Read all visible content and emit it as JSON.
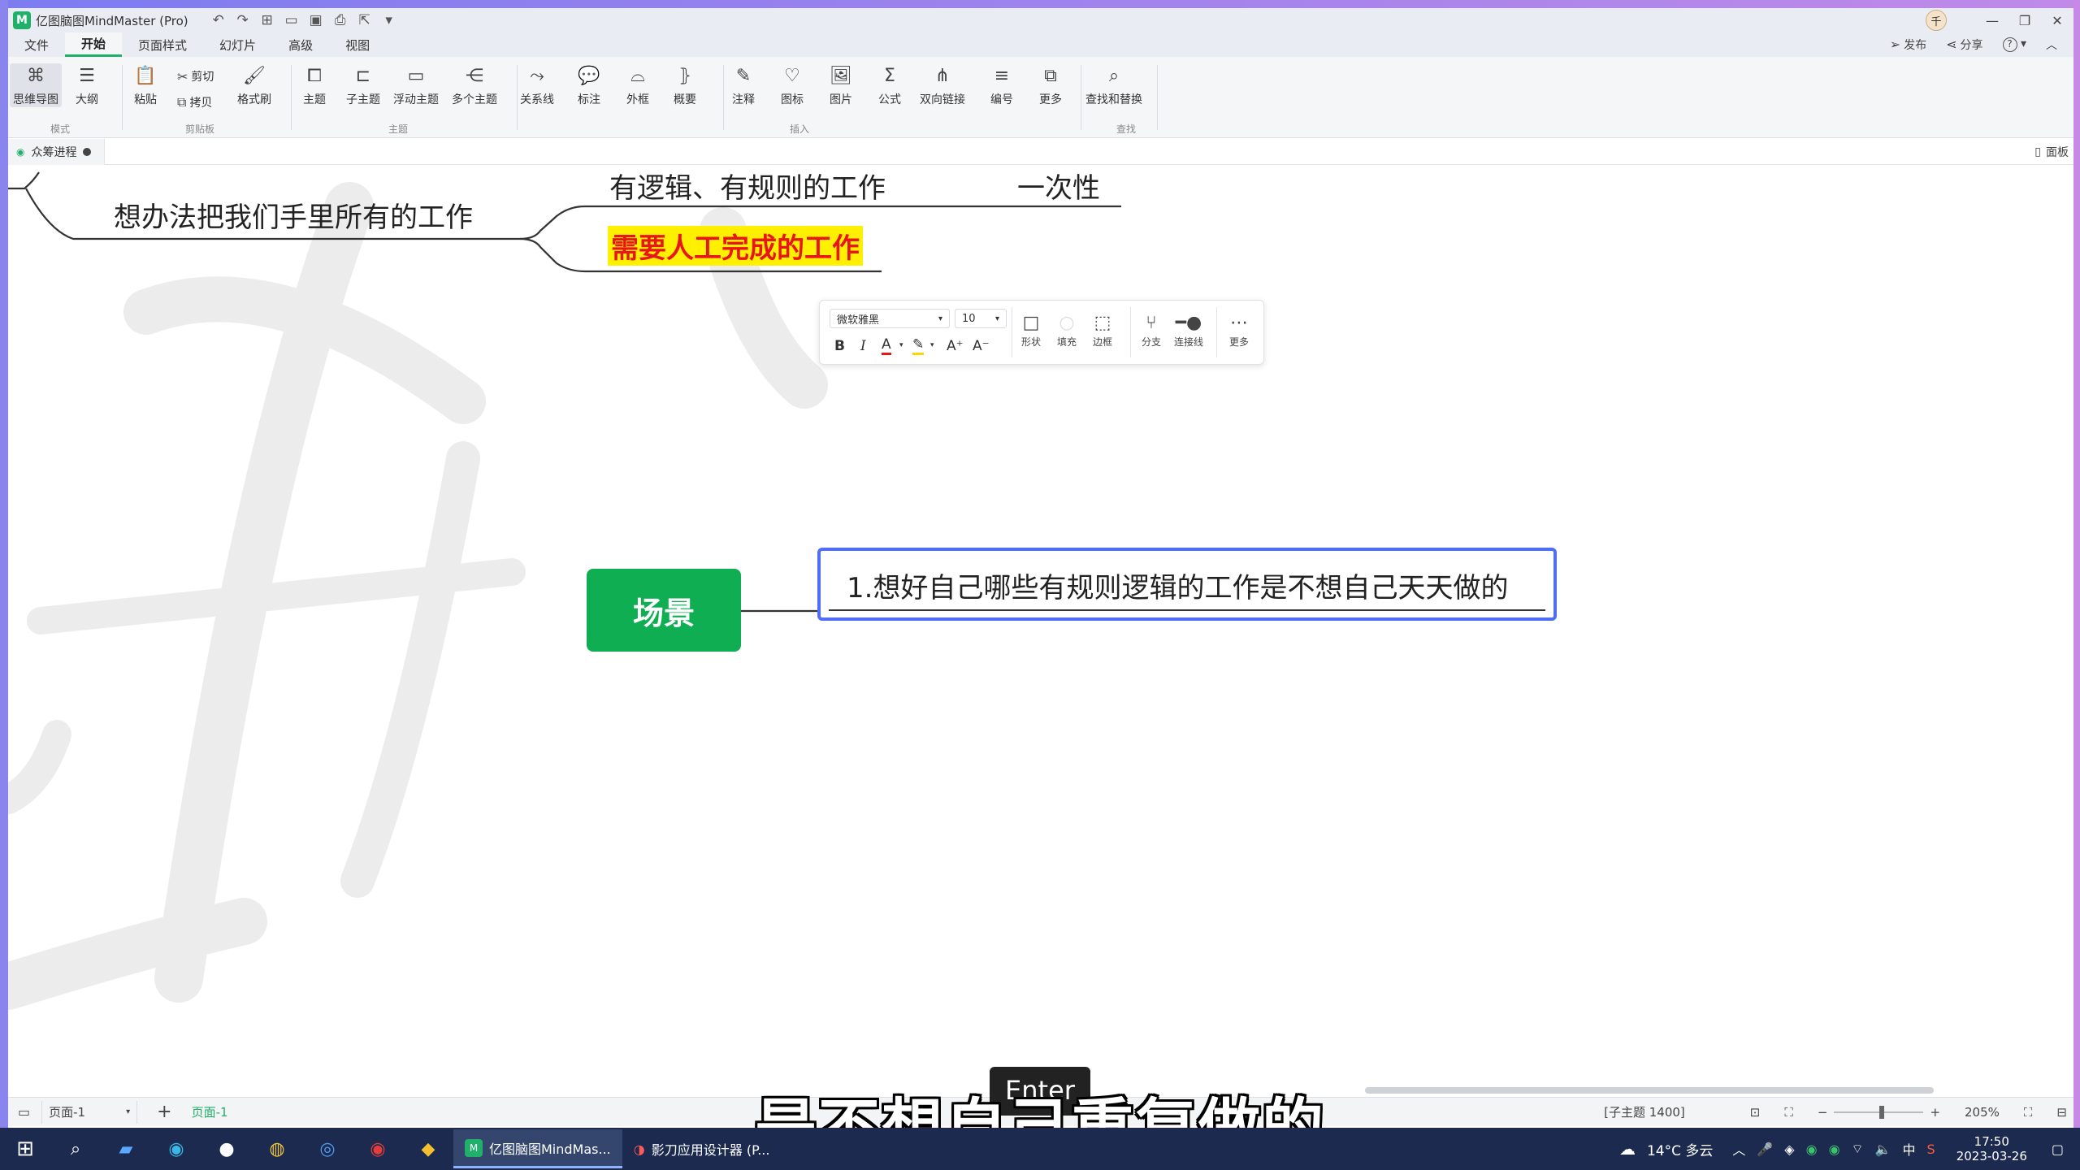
{
  "app": {
    "title": "亿图脑图MindMaster (Pro)",
    "logo_letter": "M"
  },
  "menu": {
    "tabs": [
      "文件",
      "开始",
      "页面样式",
      "幻灯片",
      "高级",
      "视图"
    ],
    "active": "开始",
    "publish": "发布",
    "share": "分享",
    "help": "?"
  },
  "ribbon": {
    "mode": {
      "mindmap": "思维导图",
      "outline": "大纲",
      "group": "模式"
    },
    "clipboard": {
      "paste": "粘贴",
      "cut": "剪切",
      "copy": "拷贝",
      "format_painter": "格式刷",
      "group": "剪贴板"
    },
    "topic": {
      "topic": "主题",
      "subtopic": "子主题",
      "floating": "浮动主题",
      "multiple": "多个主题",
      "group": "主题"
    },
    "insert": {
      "relation": "关系线",
      "callout": "标注",
      "boundary": "外框",
      "summary": "概要",
      "note": "注释",
      "icon": "图标",
      "image": "图片",
      "formula": "公式",
      "bilink": "双向链接",
      "numbering": "编号",
      "more": "更多",
      "group": "插入"
    },
    "find": {
      "find_replace": "查找和替换",
      "group": "查找"
    }
  },
  "doc": {
    "tab_name": "众筹进程",
    "panel": "面板"
  },
  "canvas": {
    "topics": {
      "parent": "想办法把我们手里所有的工作",
      "child1": "有逻辑、有规则的工作",
      "child1_tag": "一次性",
      "child2": "需要人工完成的工作",
      "central": "场景",
      "selected": "1.想好自己哪些有规则逻辑的工作是不想自己天天做的"
    }
  },
  "format_toolbar": {
    "font": "微软雅黑",
    "size": "10",
    "bold": "B",
    "italic": "I",
    "font_color": "A",
    "grow": "A⁺",
    "shrink": "A⁻",
    "shape": "形状",
    "fill": "填充",
    "border": "边框",
    "branch": "分支",
    "connector": "连接线",
    "more": "更多"
  },
  "statusbar": {
    "page_select": "页面-1",
    "add": "+",
    "page_tab": "页面-1",
    "info": "[子主题 1400]",
    "zoom": "205%"
  },
  "overlay": {
    "key_tip": "Enter",
    "subtitle": "是不想自己重复做的"
  },
  "taskbar": {
    "apps": [
      {
        "name": "亿图脑图MindMas...",
        "active": true
      },
      {
        "name": "影刀应用设计器 (P...",
        "active": false
      }
    ],
    "weather": "14°C  多云",
    "ime": "中",
    "time": "17:50",
    "date": "2023-03-26"
  },
  "colors": {
    "accent": "#1fb06a",
    "central_topic_bg": "#0fae53",
    "selection_blue": "#4f6df5",
    "highlight_yellow": "#ffef00",
    "highlight_red_text": "#e8151b",
    "taskbar_bg": "#1b2a4e"
  }
}
